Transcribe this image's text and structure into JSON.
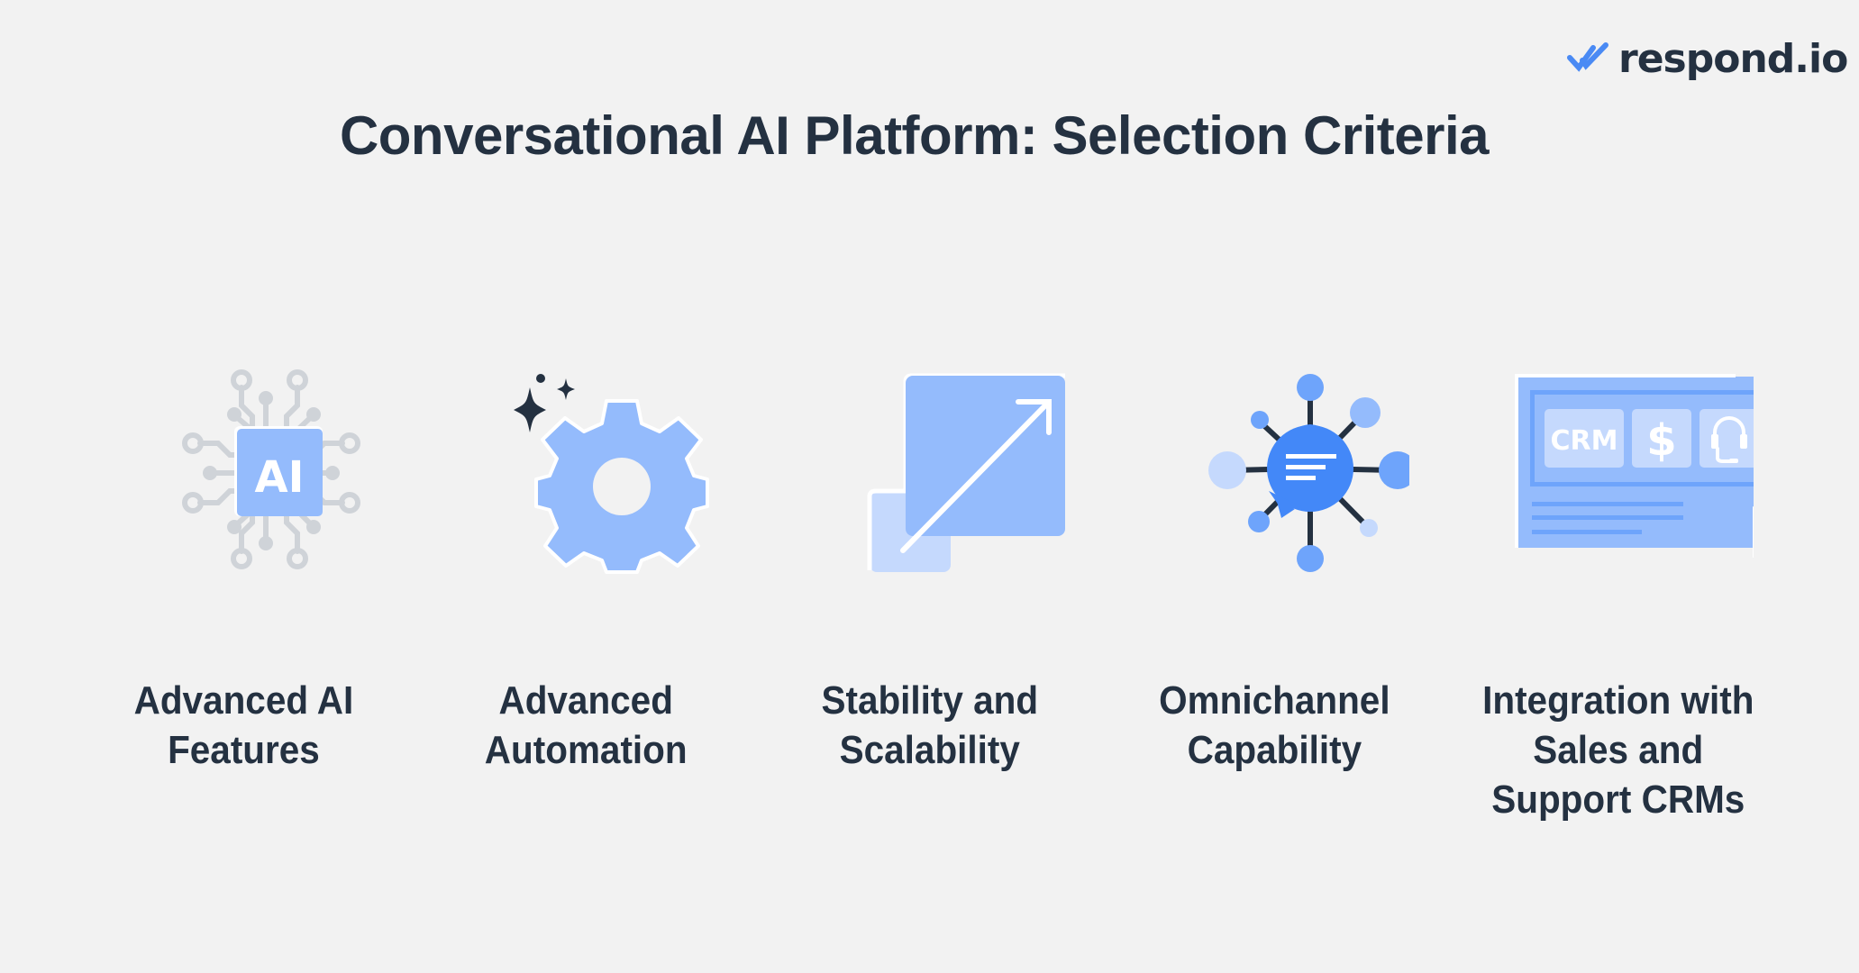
{
  "brand": {
    "logo_text": "respond.io",
    "logo_icon": "double-check-icon",
    "accent_color": "#4a8af4"
  },
  "title": "Conversational AI Platform: Selection Criteria",
  "colors": {
    "background": "#f2f2f2",
    "text": "#243141",
    "icon_blue": "#94bbfc",
    "icon_blue_light": "#c5d9fd",
    "icon_blue_strong": "#4388f8",
    "icon_gray": "#cfd3d8"
  },
  "criteria": [
    {
      "icon": "ai-chip-icon",
      "icon_text": "AI",
      "label": "Advanced AI\nFeatures"
    },
    {
      "icon": "gear-sparkle-icon",
      "label": "Advanced\nAutomation"
    },
    {
      "icon": "scale-up-arrow-icon",
      "label": "Stability and\nScalability"
    },
    {
      "icon": "chat-hub-network-icon",
      "label": "Omnichannel\nCapability"
    },
    {
      "icon": "crm-dashboard-cursor-icon",
      "icon_tiles": [
        "CRM",
        "$",
        "headset"
      ],
      "label": "Integration with\nSales and\nSupport CRMs"
    }
  ]
}
